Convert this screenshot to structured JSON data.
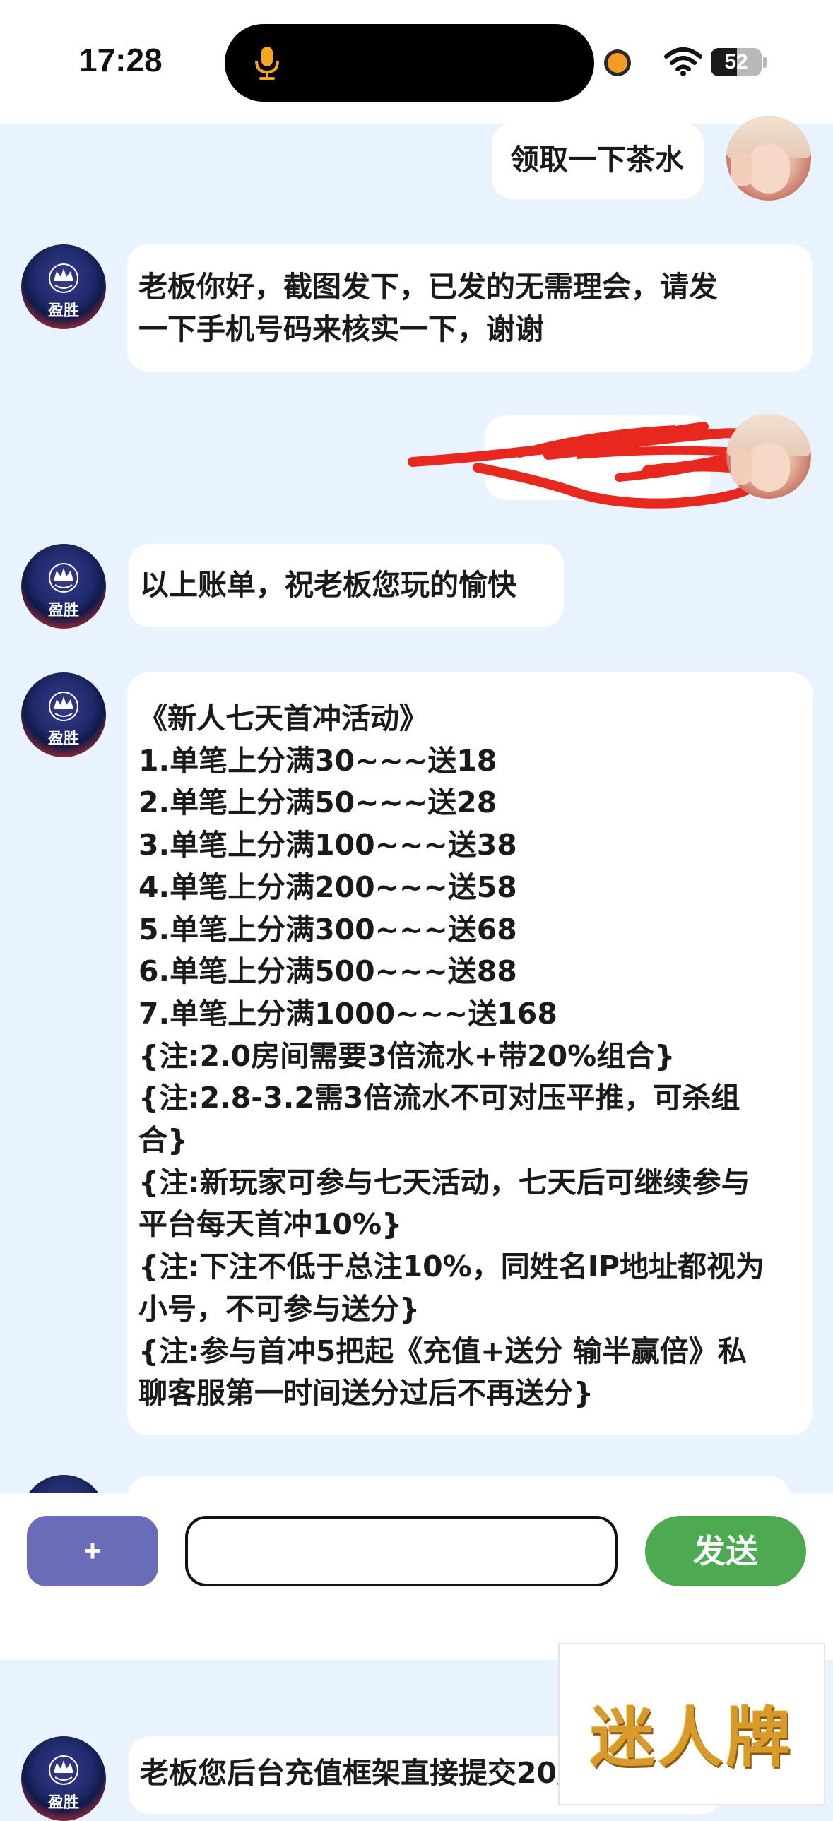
{
  "status_bar": {
    "time": "17:28",
    "battery_percent": 52,
    "battery_label": "52",
    "icons": [
      "microphone-icon",
      "recording-dot-icon",
      "wifi-icon",
      "battery-icon"
    ]
  },
  "messages": [
    {
      "side": "right",
      "sender": "user",
      "text": [
        "领取一下茶水"
      ]
    },
    {
      "side": "left",
      "sender": "brand",
      "text": [
        "老板你好，截图发下，已发的无需理会，请发",
        "一下手机号码来核实一下，谢谢"
      ]
    },
    {
      "side": "right",
      "sender": "user",
      "text": [],
      "redacted": true
    },
    {
      "side": "left",
      "sender": "brand",
      "text": [
        "以上账单，祝老板您玩的愉快"
      ]
    },
    {
      "side": "left",
      "sender": "brand",
      "text": [
        "《新人七天首冲活动》",
        "1.单笔上分满30~~~送18",
        "2.单笔上分满50~~~送28",
        "3.单笔上分满100~~~送38",
        "4.单笔上分满200~~~送58",
        "5.单笔上分满300~~~送68",
        "6.单笔上分满500~~~送88",
        "7.单笔上分满1000~~~送168",
        "{注:2.0房间需要3倍流水+带20%组合}",
        "{注:2.8-3.2需3倍流水不可对压平推，可杀组",
        "合}",
        "{注:新玩家可参与七天活动，七天后可继续参与",
        "平台每天首冲10%}",
        "{注:下注不低于总注10%，同姓名IP地址都视为",
        "小号，不可参与送分}",
        "{注:参与首冲5把起《充值+送分 输半赢倍》私",
        "聊客服第一时间送分过后不再送分}"
      ]
    },
    {
      "side": "left",
      "sender": "brand",
      "text": [
        "老板您后台充值框架直接提交20月"
      ]
    }
  ],
  "brand_avatar_label": "盈胜",
  "input_bar": {
    "plus_label": "+",
    "input_value": "",
    "send_label": "发送"
  },
  "watermark": "迷人牌",
  "colors": {
    "chat_background": "#e8f3fd",
    "plus_button": "#6b6cb7",
    "send_button": "#4daa50",
    "redaction": "#e8281e"
  }
}
